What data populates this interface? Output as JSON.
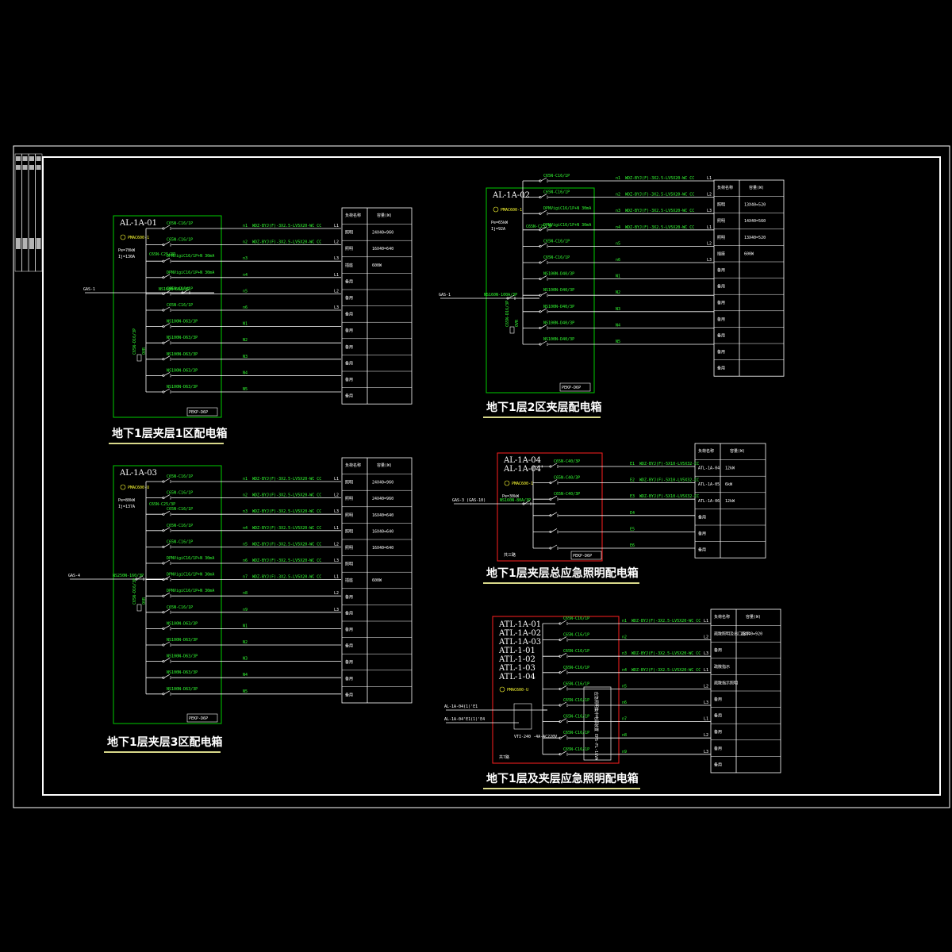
{
  "colors": {
    "frame": "#ffffff",
    "box_green": "#00cc00",
    "box_red": "#ff2020",
    "wire": "#ffffff",
    "label_green": "#33ff33",
    "yellow": "#ffff33",
    "title": "#ffffff",
    "underline": "#d8d88a"
  },
  "panels": [
    {
      "key": "p1",
      "ids": [
        "AL-1A-01"
      ],
      "meter": "PMAC600-1",
      "params": [
        "Pe=70kW",
        "Ij=130A"
      ],
      "incoming": "GAS-1",
      "main_breaker": "NS160N-60A/3P",
      "sub_breaker": "C65N-C25/3P",
      "spd": "C65N-D16/3P",
      "spd_model": "OVR",
      "pe_box": "PEKP-D6P",
      "title": "地下1层夹层1区配电箱",
      "table_header": [
        "负荷名称",
        "容量(W)"
      ],
      "circuits": [
        {
          "breaker": "C65N-C16/1P",
          "no": "n1",
          "cable": "WDZ-BYJ(F)-3X2.5-LV5X20-WC CC",
          "phase": "L1",
          "load": "照明",
          "cap": "24X40=960"
        },
        {
          "breaker": "C65N-C16/1P",
          "no": "n2",
          "cable": "WDZ-BYJ(F)-3X2.5-LV5X20-WC CC",
          "phase": "L2",
          "load": "照明",
          "cap": "16X40=640"
        },
        {
          "breaker": "DPNVigiC16/1P+N 30mA",
          "no": "n3",
          "cable": "",
          "phase": "L3",
          "load": "插座",
          "cap": "600W"
        },
        {
          "breaker": "DPNVigiC16/1P+N 30mA",
          "no": "n4",
          "cable": "",
          "phase": "L1",
          "load": "备用",
          "cap": ""
        },
        {
          "breaker": "C65N-C16/1P",
          "no": "n5",
          "cable": "",
          "phase": "L2",
          "load": "备用",
          "cap": ""
        },
        {
          "breaker": "C65N-C16/1P",
          "no": "n6",
          "cable": "",
          "phase": "L3",
          "load": "备用",
          "cap": ""
        },
        {
          "breaker": "NS100N-D63/3P",
          "no": "N1",
          "cable": "",
          "phase": "",
          "load": "备用",
          "cap": ""
        },
        {
          "breaker": "NS100N-D63/3P",
          "no": "N2",
          "cable": "",
          "phase": "",
          "load": "备用",
          "cap": ""
        },
        {
          "breaker": "NS100N-D63/3P",
          "no": "N3",
          "cable": "",
          "phase": "",
          "load": "备用",
          "cap": ""
        },
        {
          "breaker": "NS100N-D63/3P",
          "no": "N4",
          "cable": "",
          "phase": "",
          "load": "备用",
          "cap": ""
        },
        {
          "breaker": "NS100N-D63/3P",
          "no": "N5",
          "cable": "",
          "phase": "",
          "load": "备用",
          "cap": ""
        }
      ]
    },
    {
      "key": "p2",
      "ids": [
        "AL-1A-02"
      ],
      "meter": "PMAC600-1",
      "params": [
        "Pe=65kW",
        "Ij=92A"
      ],
      "incoming": "GAS-1",
      "main_breaker": "NS160N-100A/3P",
      "sub_breaker": "C65N-C25/3P",
      "spd": "C65N-D16/3P",
      "spd_model": "OVR",
      "pe_box": "PEKP-D6P",
      "title": "地下1层2区夹层配电箱",
      "table_header": [
        "负荷名称",
        "容量(W)"
      ],
      "circuits": [
        {
          "breaker": "C65N-C16/1P",
          "no": "n1",
          "cable": "WDZ-BYJ(F)-3X2.5-LV5X20-WC CC",
          "phase": "L1",
          "load": "照明",
          "cap": "13X40=520"
        },
        {
          "breaker": "C65N-C16/1P",
          "no": "n2",
          "cable": "WDZ-BYJ(F)-3X2.5-LV5X20-WC CC",
          "phase": "L2",
          "load": "照明",
          "cap": "14X40=560"
        },
        {
          "breaker": "DPNVigiC16/1P+N 30mA",
          "no": "n3",
          "cable": "WDZ-BYJ(F)-3X2.5-LV5X20-WC CC",
          "phase": "L3",
          "load": "照明",
          "cap": "13X40=520"
        },
        {
          "breaker": "DPNVigiC16/1P+N 30mA",
          "no": "n4",
          "cable": "WDZ-BYJ(F)-3X2.5-LV5X20-WC CC",
          "phase": "L1",
          "load": "插座",
          "cap": "600W"
        },
        {
          "breaker": "C65N-C16/1P",
          "no": "n5",
          "cable": "",
          "phase": "L2",
          "load": "备用",
          "cap": ""
        },
        {
          "breaker": "C65N-C16/1P",
          "no": "n6",
          "cable": "",
          "phase": "L3",
          "load": "备用",
          "cap": ""
        },
        {
          "breaker": "NS100N-D40/3P",
          "no": "N1",
          "cable": "",
          "phase": "",
          "load": "备用",
          "cap": ""
        },
        {
          "breaker": "NS100N-D40/3P",
          "no": "N2",
          "cable": "",
          "phase": "",
          "load": "备用",
          "cap": ""
        },
        {
          "breaker": "NS100N-D40/3P",
          "no": "N3",
          "cable": "",
          "phase": "",
          "load": "备用",
          "cap": ""
        },
        {
          "breaker": "NS100N-D40/3P",
          "no": "N4",
          "cable": "",
          "phase": "",
          "load": "备用",
          "cap": ""
        },
        {
          "breaker": "NS100N-D40/3P",
          "no": "N5",
          "cable": "",
          "phase": "",
          "load": "备用",
          "cap": ""
        }
      ]
    },
    {
      "key": "p3",
      "ids": [
        "AL-1A-03"
      ],
      "meter": "PMAC600-U",
      "params": [
        "Pe=80kW",
        "Ij=137A"
      ],
      "incoming": "GAS-4",
      "main_breaker": "NS250N-160/3P",
      "sub_breaker": "C65N-C25/3P",
      "spd": "C65N-D16/3P",
      "spd_model": "OVR",
      "pe_box": "PEKP-D6P",
      "title": "地下1层夹层3区配电箱",
      "table_header": [
        "负荷名称",
        "容量(W)"
      ],
      "circuits": [
        {
          "breaker": "C65N-C16/1P",
          "no": "n1",
          "cable": "WDZ-BYJ(F)-3X2.5-LV5X20-WC CC",
          "phase": "L1",
          "load": "照明",
          "cap": "24X40=960"
        },
        {
          "breaker": "C65N-C16/1P",
          "no": "n2",
          "cable": "WDZ-BYJ(F)-3X2.5-LV5X20-WC CC",
          "phase": "L2",
          "load": "照明",
          "cap": "24X40=960"
        },
        {
          "breaker": "C65N-C16/1P",
          "no": "n3",
          "cable": "WDZ-BYJ(F)-3X2.5-LV5X20-WC CC",
          "phase": "L3",
          "load": "照明",
          "cap": "16X40=640"
        },
        {
          "breaker": "C65N-C16/1P",
          "no": "n4",
          "cable": "WDZ-BYJ(F)-3X2.5-LV5X20-WC CC",
          "phase": "L1",
          "load": "照明",
          "cap": "16X40=640"
        },
        {
          "breaker": "C65N-C16/1P",
          "no": "n5",
          "cable": "WDZ-BYJ(F)-3X2.5-LV5X20-WC CC",
          "phase": "L2",
          "load": "照明",
          "cap": "16X40=640"
        },
        {
          "breaker": "DPNVigiC16/1P+N 30mA",
          "no": "n6",
          "cable": "WDZ-BYJ(F)-3X2.5-LV5X20-WC CC",
          "phase": "L3",
          "load": "照明",
          "cap": ""
        },
        {
          "breaker": "DPNVigiC16/1P+N 30mA",
          "no": "n7",
          "cable": "WDZ-BYJ(F)-3X2.5-LV5X20-WC CC",
          "phase": "L1",
          "load": "插座",
          "cap": "600W"
        },
        {
          "breaker": "DPNVigiC16/1P+N 30mA",
          "no": "n8",
          "cable": "",
          "phase": "L2",
          "load": "备用",
          "cap": ""
        },
        {
          "breaker": "C65N-C16/1P",
          "no": "n9",
          "cable": "",
          "phase": "L3",
          "load": "备用",
          "cap": ""
        },
        {
          "breaker": "NS100N-D63/3P",
          "no": "N1",
          "cable": "",
          "phase": "",
          "load": "备用",
          "cap": ""
        },
        {
          "breaker": "NS100N-D63/3P",
          "no": "N2",
          "cable": "",
          "phase": "",
          "load": "备用",
          "cap": ""
        },
        {
          "breaker": "NS100N-D63/3P",
          "no": "N3",
          "cable": "",
          "phase": "",
          "load": "备用",
          "cap": ""
        },
        {
          "breaker": "NS100N-D63/3P",
          "no": "N4",
          "cable": "",
          "phase": "",
          "load": "备用",
          "cap": ""
        },
        {
          "breaker": "NS100N-D63/3P",
          "no": "N5",
          "cable": "",
          "phase": "",
          "load": "备用",
          "cap": ""
        }
      ]
    },
    {
      "key": "p4",
      "ids": [
        "AL-1A-04",
        "AL-1A-04'"
      ],
      "meter": "PMAC600-1",
      "params": [
        "Pe=30kW"
      ],
      "incoming": "GAS-3 (GAS-10)",
      "main_breaker": "NS160N-80A/3P",
      "sub_breaker": "",
      "spd": "",
      "spd_model": "OVR",
      "pe_box": "PEKP-D6P",
      "title": "地下1层夹层总应急照明配电箱",
      "table_header": [
        "负荷名称",
        "容量(W)"
      ],
      "footer": "共三路",
      "circuits": [
        {
          "breaker": "C65N-C40/3P",
          "no": "E1",
          "cable": "WDZ-BYJ(F)-5X10-LV5X32-CC",
          "phase": "",
          "load": "ATL-1A-04",
          "cap": "12kW"
        },
        {
          "breaker": "C65N-C40/3P",
          "no": "E2",
          "cable": "WDZ-BYJ(F)-5X10-LV5X32-CC",
          "phase": "",
          "load": "ATL-1A-05",
          "cap": "6kW"
        },
        {
          "breaker": "C65N-C40/3P",
          "no": "E3",
          "cable": "WDZ-BYJ(F)-5X10-LV5X32-CC",
          "phase": "",
          "load": "ATL-1A-06",
          "cap": "12kW"
        },
        {
          "breaker": "",
          "no": "E4",
          "cable": "",
          "phase": "",
          "load": "备用",
          "cap": ""
        },
        {
          "breaker": "",
          "no": "E5",
          "cable": "",
          "phase": "",
          "load": "备用",
          "cap": ""
        },
        {
          "breaker": "",
          "no": "E6",
          "cable": "",
          "phase": "",
          "load": "备用",
          "cap": ""
        }
      ]
    },
    {
      "key": "p5",
      "ids": [
        "ATL-1A-01",
        "ATL-1A-02",
        "ATL-1A-03",
        "ATL-1-01",
        "ATL-1-02",
        "ATL-1-03",
        "ATL-1-04"
      ],
      "meter": "PMAC600-U",
      "params": [],
      "incoming": "AL-1A-04(1)'E1",
      "incoming2": "AL-1A-04'E1(1)'E4",
      "ats": "VTI-240 -4A-AC220V",
      "ups_label": "应急照明集中电源装置 EPS-FL-1kVA",
      "footer": "共7路",
      "title": "地下1层及夹层应急照明配电箱",
      "table_header": [
        "负荷名称",
        "容量(W)"
      ],
      "circuits": [
        {
          "breaker": "C65N-C16/1P",
          "no": "n1",
          "cable": "WDZ-BYJ(F)-3X2.5-LV5X20-WC CC",
          "phase": "L1",
          "load": "疏散照明及出口指示",
          "cap": "23X40=920"
        },
        {
          "breaker": "C65N-C16/1P",
          "no": "n2",
          "cable": "",
          "phase": "L2",
          "load": "备用",
          "cap": ""
        },
        {
          "breaker": "C65N-C16/1P",
          "no": "n3",
          "cable": "WDZ-BYJ(F)-3X2.5-LV5X20-WC CC",
          "phase": "L3",
          "load": "疏散指示",
          "cap": ""
        },
        {
          "breaker": "C65N-C16/1P",
          "no": "n4",
          "cable": "WDZ-BYJ(F)-3X2.5-LV5X20-WC CC",
          "phase": "L1",
          "load": "疏散指示照明",
          "cap": ""
        },
        {
          "breaker": "C65N-C16/1P",
          "no": "n5",
          "cable": "",
          "phase": "L2",
          "load": "备用",
          "cap": ""
        },
        {
          "breaker": "C65N-C16/1P",
          "no": "n6",
          "cable": "",
          "phase": "L3",
          "load": "备用",
          "cap": ""
        },
        {
          "breaker": "C65N-C16/1P",
          "no": "n7",
          "cable": "",
          "phase": "L1",
          "load": "备用",
          "cap": ""
        },
        {
          "breaker": "C65N-C16/1P",
          "no": "n8",
          "cable": "",
          "phase": "L2",
          "load": "备用",
          "cap": ""
        },
        {
          "breaker": "C65N-C16/1P",
          "no": "n9",
          "cable": "",
          "phase": "L3",
          "load": "备用",
          "cap": ""
        }
      ]
    }
  ]
}
